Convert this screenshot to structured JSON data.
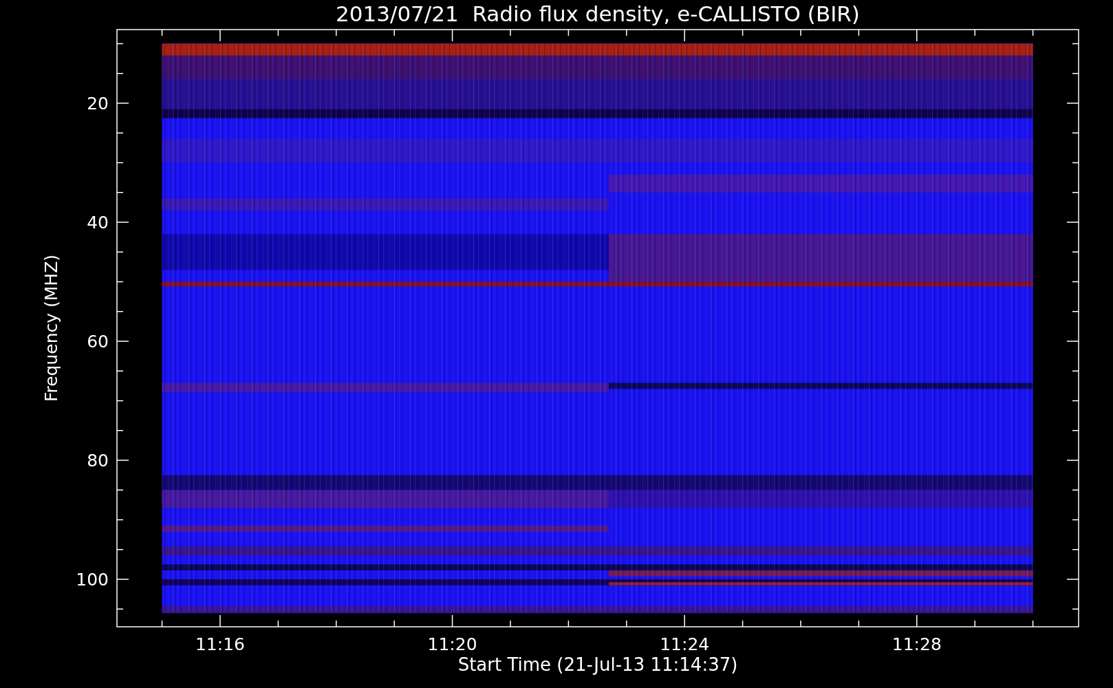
{
  "title": "2013/07/21  Radio flux density, e-CALLISTO (BIR)",
  "ylabel": "Frequency (MHZ)",
  "xlabel": "Start Time (21-Jul-13 11:14:37)",
  "yticks": [
    "20",
    "40",
    "60",
    "80",
    "100"
  ],
  "xticks": [
    "11:16",
    "11:20",
    "11:24",
    "11:28"
  ]
}
